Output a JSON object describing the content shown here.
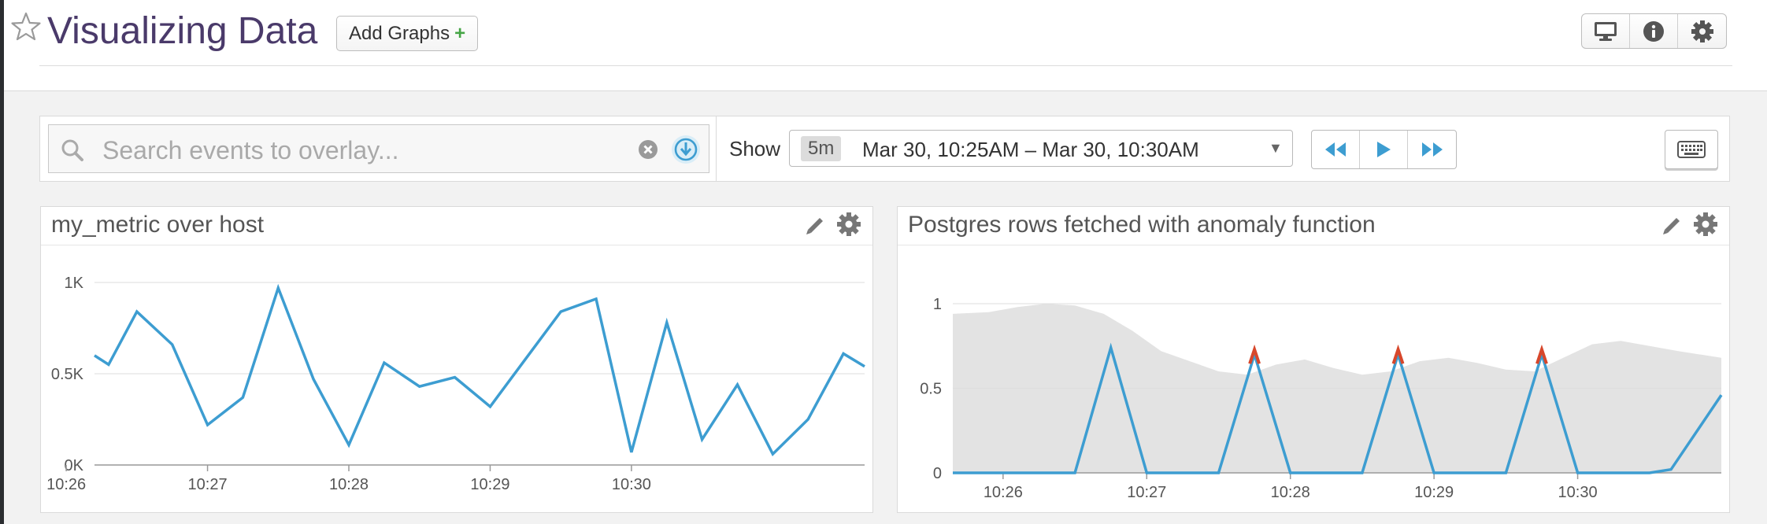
{
  "header": {
    "title": "Visualizing Data",
    "add_graphs_label": "Add Graphs",
    "add_graphs_plus": "+",
    "icons": [
      "star-icon",
      "monitor-icon",
      "info-icon",
      "gear-icon"
    ]
  },
  "toolbar": {
    "search_placeholder": "Search events to overlay...",
    "show_label": "Show",
    "time_pill": "5m",
    "time_range": "Mar 30, 10:25AM – Mar 30, 10:30AM",
    "caret": "▼",
    "icons": [
      "search-icon",
      "clear-icon",
      "download-icon",
      "rewind-icon",
      "play-icon",
      "fast-forward-icon",
      "keyboard-icon"
    ]
  },
  "colors": {
    "accent": "#3d9dd1",
    "title": "#4a3a6a",
    "anomaly": "#d7472b",
    "band": "#e3e3e3"
  },
  "panels": [
    {
      "title": "my_metric over host"
    },
    {
      "title": "Postgres rows fetched with anomaly function"
    }
  ],
  "chart_data": [
    {
      "type": "line",
      "title": "my_metric over host",
      "x_ticks": [
        "10:26",
        "10:27",
        "10:28",
        "10:29",
        "10:30"
      ],
      "y_ticks": [
        "1K",
        "0.5K",
        "0K"
      ],
      "ylim": [
        0,
        1000
      ],
      "x_range_minutes": [
        10.2,
        15.65
      ],
      "grid": true,
      "series": [
        {
          "x": [
            10.2,
            10.3,
            10.5,
            10.75,
            11.0,
            11.25,
            11.5,
            11.75,
            12.0,
            12.25,
            12.5,
            12.75,
            13.0,
            13.25,
            13.5,
            13.75,
            14.0,
            14.25,
            14.5,
            14.75,
            15.0,
            15.25,
            15.5,
            15.65
          ],
          "y": [
            600,
            550,
            840,
            660,
            220,
            370,
            970,
            470,
            110,
            560,
            430,
            480,
            320,
            580,
            840,
            910,
            70,
            780,
            140,
            440,
            60,
            250,
            610,
            540
          ]
        }
      ]
    },
    {
      "type": "line",
      "title": "Postgres rows fetched with anomaly function",
      "x_ticks": [
        "10:26",
        "10:27",
        "10:28",
        "10:29",
        "10:30"
      ],
      "y_ticks": [
        "1",
        "0.5",
        "0"
      ],
      "ylim": [
        0,
        1
      ],
      "x_range_minutes": [
        25.65,
        31.0
      ],
      "grid": true,
      "band": {
        "x": [
          25.65,
          25.9,
          26.1,
          26.3,
          26.5,
          26.7,
          26.9,
          27.1,
          27.3,
          27.5,
          27.7,
          27.9,
          28.1,
          28.3,
          28.5,
          28.7,
          28.9,
          29.1,
          29.3,
          29.5,
          29.7,
          29.9,
          30.1,
          30.3,
          30.5,
          30.7,
          31.0
        ],
        "upper": [
          0.94,
          0.95,
          0.98,
          1.0,
          0.99,
          0.94,
          0.84,
          0.72,
          0.66,
          0.6,
          0.58,
          0.64,
          0.67,
          0.62,
          0.58,
          0.6,
          0.66,
          0.68,
          0.65,
          0.61,
          0.6,
          0.68,
          0.76,
          0.78,
          0.75,
          0.72,
          0.68
        ],
        "lower": [
          0,
          0,
          0,
          0,
          0,
          0,
          0,
          0,
          0,
          0,
          0,
          0,
          0,
          0,
          0,
          0,
          0,
          0,
          0,
          0,
          0,
          0,
          0,
          0,
          0,
          0,
          0
        ]
      },
      "series": [
        {
          "x": [
            25.65,
            26.0,
            26.5,
            26.75,
            27.0,
            27.5,
            27.75,
            28.0,
            28.5,
            28.75,
            29.0,
            29.5,
            29.75,
            30.0,
            30.5,
            30.65,
            31.0
          ],
          "y": [
            0,
            0,
            0,
            0.74,
            0,
            0,
            0.7,
            0,
            0,
            0.7,
            0,
            0,
            0.7,
            0,
            0,
            0.02,
            0.46
          ]
        }
      ],
      "anomalies": [
        {
          "x": 27.75,
          "y": 0.72
        },
        {
          "x": 28.75,
          "y": 0.72
        },
        {
          "x": 29.75,
          "y": 0.72
        }
      ]
    }
  ]
}
